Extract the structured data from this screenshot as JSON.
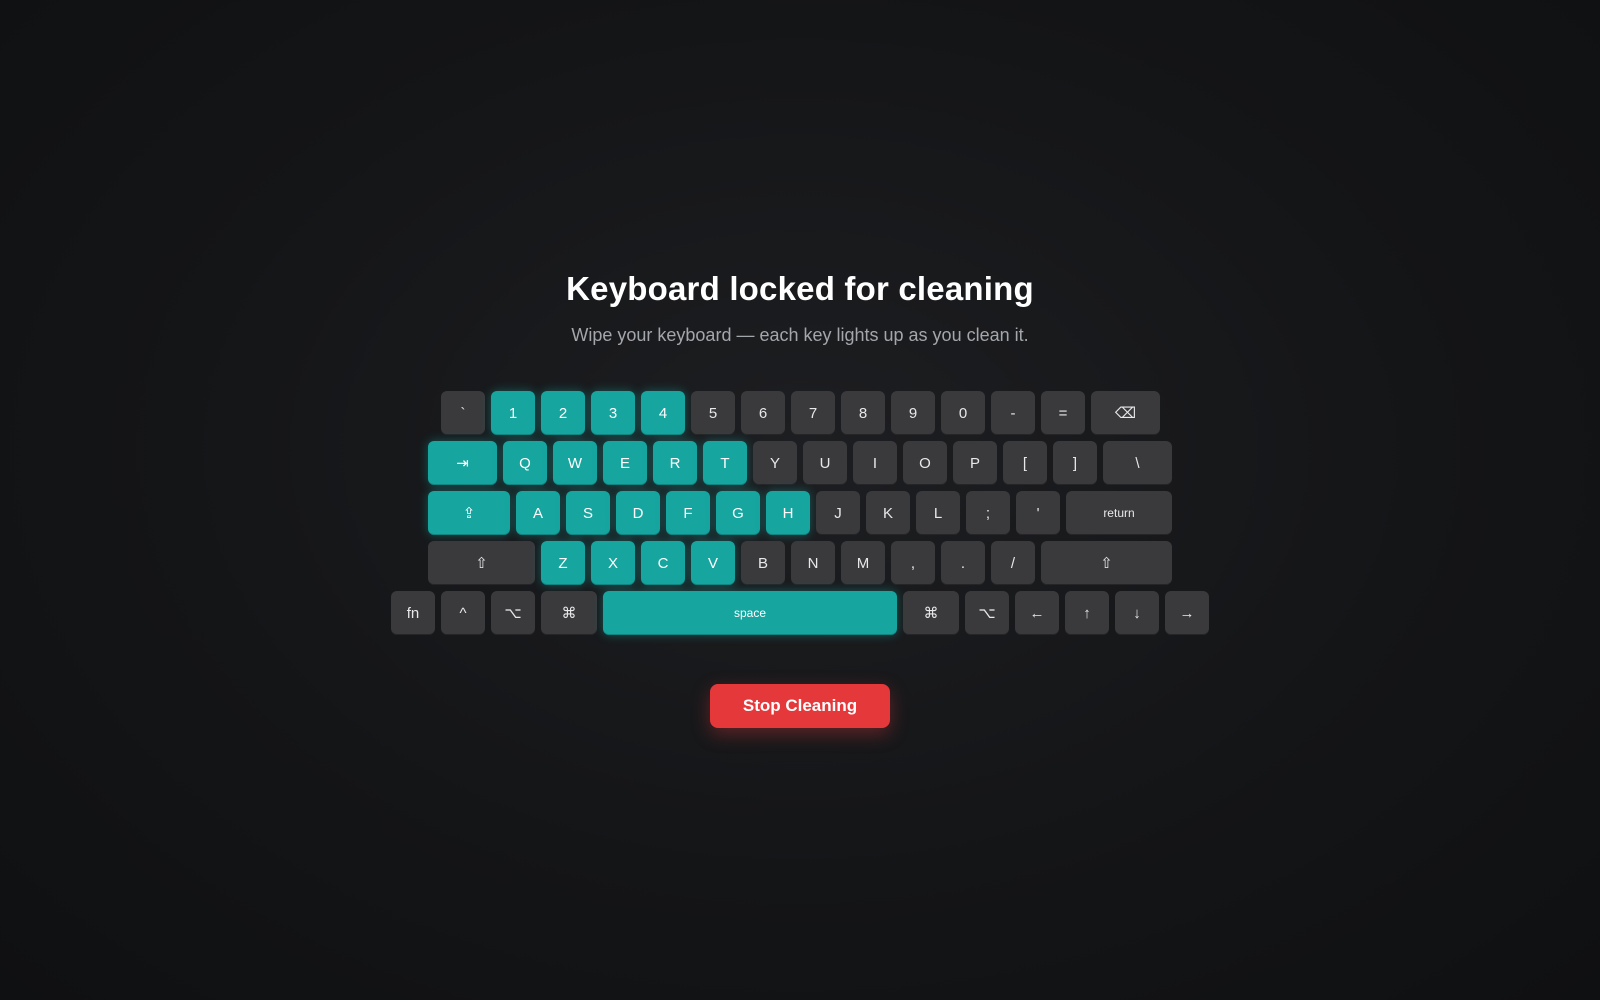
{
  "app": {
    "title": "Keyboard locked for cleaning",
    "subtitle": "Wipe your keyboard — each key lights up as you clean it.",
    "stop_label": "Stop Cleaning"
  },
  "colors": {
    "cleaned_key": "#17a5a0",
    "idle_key": "#3a3a3c",
    "stop_button": "#e5383b",
    "background": "#141517"
  },
  "keyboard": {
    "rows": [
      [
        {
          "label": "`",
          "id": "backtick",
          "cleaned": false
        },
        {
          "label": "1",
          "id": "1",
          "cleaned": true
        },
        {
          "label": "2",
          "id": "2",
          "cleaned": true
        },
        {
          "label": "3",
          "id": "3",
          "cleaned": true
        },
        {
          "label": "4",
          "id": "4",
          "cleaned": true
        },
        {
          "label": "5",
          "id": "5",
          "cleaned": false
        },
        {
          "label": "6",
          "id": "6",
          "cleaned": false
        },
        {
          "label": "7",
          "id": "7",
          "cleaned": false
        },
        {
          "label": "8",
          "id": "8",
          "cleaned": false
        },
        {
          "label": "9",
          "id": "9",
          "cleaned": false
        },
        {
          "label": "0",
          "id": "0",
          "cleaned": false
        },
        {
          "label": "-",
          "id": "minus",
          "cleaned": false
        },
        {
          "label": "=",
          "id": "equals",
          "cleaned": false
        },
        {
          "label": "⌫",
          "id": "delete",
          "icon": "backspace-icon",
          "cleaned": false
        }
      ],
      [
        {
          "label": "⇥",
          "id": "tab",
          "icon": "tab-icon",
          "cleaned": true
        },
        {
          "label": "Q",
          "id": "q",
          "cleaned": true
        },
        {
          "label": "W",
          "id": "w",
          "cleaned": true
        },
        {
          "label": "E",
          "id": "e",
          "cleaned": true
        },
        {
          "label": "R",
          "id": "r",
          "cleaned": true
        },
        {
          "label": "T",
          "id": "t",
          "cleaned": true
        },
        {
          "label": "Y",
          "id": "y",
          "cleaned": false
        },
        {
          "label": "U",
          "id": "u",
          "cleaned": false
        },
        {
          "label": "I",
          "id": "i",
          "cleaned": false
        },
        {
          "label": "O",
          "id": "o",
          "cleaned": false
        },
        {
          "label": "P",
          "id": "p",
          "cleaned": false
        },
        {
          "label": "[",
          "id": "left-bracket",
          "cleaned": false
        },
        {
          "label": "]",
          "id": "right-bracket",
          "cleaned": false
        },
        {
          "label": "\\",
          "id": "backslash",
          "cleaned": false
        }
      ],
      [
        {
          "label": "⇪",
          "id": "caps-lock",
          "icon": "caps-lock-icon",
          "cleaned": true
        },
        {
          "label": "A",
          "id": "a",
          "cleaned": true
        },
        {
          "label": "S",
          "id": "s",
          "cleaned": true
        },
        {
          "label": "D",
          "id": "d",
          "cleaned": true
        },
        {
          "label": "F",
          "id": "f",
          "cleaned": true
        },
        {
          "label": "G",
          "id": "g",
          "cleaned": true
        },
        {
          "label": "H",
          "id": "h",
          "cleaned": true
        },
        {
          "label": "J",
          "id": "j",
          "cleaned": false
        },
        {
          "label": "K",
          "id": "k",
          "cleaned": false
        },
        {
          "label": "L",
          "id": "l",
          "cleaned": false
        },
        {
          "label": ";",
          "id": "semicolon",
          "cleaned": false
        },
        {
          "label": "'",
          "id": "quote",
          "cleaned": false
        },
        {
          "label": "return",
          "id": "return",
          "cleaned": false
        }
      ],
      [
        {
          "label": "⇧",
          "id": "left-shift",
          "icon": "shift-icon",
          "cleaned": false
        },
        {
          "label": "Z",
          "id": "z",
          "cleaned": true
        },
        {
          "label": "X",
          "id": "x",
          "cleaned": true
        },
        {
          "label": "C",
          "id": "c",
          "cleaned": true
        },
        {
          "label": "V",
          "id": "v",
          "cleaned": true
        },
        {
          "label": "B",
          "id": "b",
          "cleaned": false
        },
        {
          "label": "N",
          "id": "n",
          "cleaned": false
        },
        {
          "label": "M",
          "id": "m",
          "cleaned": false
        },
        {
          "label": ",",
          "id": "comma",
          "cleaned": false
        },
        {
          "label": ".",
          "id": "period",
          "cleaned": false
        },
        {
          "label": "/",
          "id": "slash",
          "cleaned": false
        },
        {
          "label": "⇧",
          "id": "right-shift",
          "icon": "shift-icon",
          "cleaned": false
        }
      ],
      [
        {
          "label": "fn",
          "id": "fn",
          "cleaned": false
        },
        {
          "label": "^",
          "id": "control",
          "icon": "control-icon",
          "cleaned": false
        },
        {
          "label": "⌥",
          "id": "left-option",
          "icon": "option-icon",
          "cleaned": false
        },
        {
          "label": "⌘",
          "id": "left-command",
          "icon": "command-icon",
          "cleaned": false
        },
        {
          "label": "space",
          "id": "space",
          "cleaned": true
        },
        {
          "label": "⌘",
          "id": "right-command",
          "icon": "command-icon",
          "cleaned": false
        },
        {
          "label": "⌥",
          "id": "right-option",
          "icon": "option-icon",
          "cleaned": false
        },
        {
          "label": "←",
          "id": "arrow-left",
          "icon": "arrow-left-icon",
          "cleaned": false
        },
        {
          "label": "↑",
          "id": "arrow-up",
          "icon": "arrow-up-icon",
          "cleaned": false
        },
        {
          "label": "↓",
          "id": "arrow-down",
          "icon": "arrow-down-icon",
          "cleaned": false
        },
        {
          "label": "→",
          "id": "arrow-right",
          "icon": "arrow-right-icon",
          "cleaned": false
        }
      ]
    ]
  }
}
